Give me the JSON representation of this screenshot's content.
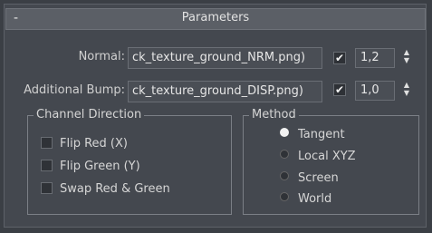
{
  "panel": {
    "title": "Parameters",
    "collapse_symbol": "-"
  },
  "normal": {
    "label": "Normal:",
    "file": "ck_texture_ground_NRM.png)",
    "enabled_mark": "✔",
    "value": "1,2"
  },
  "bump": {
    "label": "Additional Bump:",
    "file": "ck_texture_ground_DISP.png)",
    "enabled_mark": "✔",
    "value": "1,0"
  },
  "channel_direction": {
    "title": "Channel Direction",
    "options": [
      "Flip Red (X)",
      "Flip Green (Y)",
      "Swap Red & Green"
    ]
  },
  "method": {
    "title": "Method",
    "options": [
      "Tangent",
      "Local XYZ",
      "Screen",
      "World"
    ],
    "selected": "Tangent"
  },
  "icons": {
    "spinner": "spinner-up-down-icon",
    "collapse": "minus-icon"
  }
}
